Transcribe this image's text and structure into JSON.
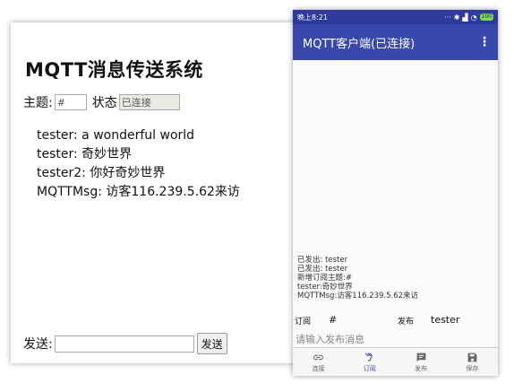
{
  "web": {
    "title": "MQTT消息传送系统",
    "topic_label": "主题:",
    "topic_value": "#",
    "status_label": "状态",
    "status_value": "已连接",
    "messages": [
      "tester: a wonderful world",
      "tester: 奇妙世界",
      "tester2: 你好奇妙世界",
      "MQTTMsg: 访客116.239.5.62来访"
    ],
    "send_label": "发送:",
    "send_value": "",
    "send_button": "发送"
  },
  "phone": {
    "status_bar": {
      "time": "晚上8:21",
      "battery": "100"
    },
    "app_title": "MQTT客户端(已连接)",
    "log_lines": [
      "已发出: tester",
      "已发出: tester",
      "新增订阅主题:#",
      "tester:奇妙世界",
      "MQTTMsg:访客116.239.5.62来访"
    ],
    "subscribe_label": "订阅",
    "subscribe_value": "#",
    "publish_label": "发布",
    "publish_value": "tester",
    "publish_placeholder": "请输入发布消息",
    "nav": [
      {
        "label": "连接",
        "icon": "link-icon",
        "active": false
      },
      {
        "label": "订阅",
        "icon": "ear-icon",
        "active": true
      },
      {
        "label": "发布",
        "icon": "message-icon",
        "active": false
      },
      {
        "label": "保存",
        "icon": "save-icon",
        "active": false
      }
    ],
    "accent_color": "#3949ab"
  }
}
